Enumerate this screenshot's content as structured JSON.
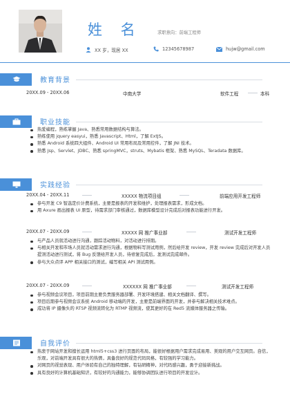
{
  "header": {
    "name": "姓 名",
    "intent": "求职意向：前端工程师",
    "age_location": "XX 岁，现居 XX",
    "phone": "12345678987",
    "email": "hujw@gmail.com"
  },
  "education": {
    "title": "教育背景",
    "period": "20XX.09 - 20XX.06",
    "school": "中南大学",
    "major": "软件工程",
    "degree": "本科"
  },
  "skills": {
    "title": "职业技能",
    "items": [
      "热爱编程，熟练掌握 Java、熟悉常用数据结构与算法。",
      "熟练使用 jquery easyui，熟悉 Javascript、Html，了解 ExtJS。",
      "熟悉 Android 系统四大组件、Android UI 常用布局及常用控件，了解 JNI 技术。",
      "熟悉 Jsp、Servlet、JDBC、熟悉 springMVC，struts、Mybatis 框架、熟悉 MySQL、Teradata 数据库。"
    ]
  },
  "experience": {
    "title": "实践经验",
    "jobs": [
      {
        "period": "20XX.04 - 20XX.11",
        "project": "XXXXX 物流项目组",
        "role": "前端应用开发工程师",
        "items": [
          "参与开发 C9 智选定价计费系统，主要是报表的开发和维护，处理报表需求，形成文档。",
          "用 Axure 画出报表 UI 原型，待需求部门审核通过，数据库模型设计完成后对报表功能进行开发。"
        ]
      },
      {
        "period": "20XX.07 - 20XX.09",
        "project": "XXXXX 网 推广事业部",
        "role": "测试开发工程师",
        "items": [
          "与产品人员就活动进行沟通，跟踪活动物料，对活动进行排期。",
          "与相关开发和市场人员就活动需求进行沟通，根据物料写测试用例，然后给开发 review，开发 review 完成后对开发人员提测活动进行测试，将 Bug 反馈给开发人员，待修复完成后，发测试完成邮件。",
          "参与大众点评 APP 相关接口的测试，编写相关 API 测试用例。"
        ]
      },
      {
        "period": "20XX.07 - 20XX.09",
        "project": "XXXXXX 网 推广事业部",
        "role": "测试开发工程师",
        "items": [
          "参与视频会议项目，项目前期主要负责服务器部署、开发环境搭建、相关文档翻译、撰写。",
          "项目后期参与视频会议系统 Android 移动端的开发，主要是前端界面的开发，并参与解决相关技术难点。",
          "成功将 IP 摄像头的 RTSP 视频流转化为 RTMP 视频流，使其更好的在 Red5 流媒体服务器之传输。"
        ]
      }
    ]
  },
  "self_eval": {
    "title": "自我评价",
    "items": [
      "热衷于网站开发和擅长运用 html5+css3 进行页面的布局，能很好根据用户需求完成易用、美观的用户交互网页。自信，乐观，对前端开发具有很大的热情，具备良好的规范代码风格，有较强的学习能力。",
      "对网页的视觉表现、用户体验有自己的独特理解，有钻研精神，对代码感兴趣，勇于迎接新挑战。",
      "具有良好的计算机基础知识，有较好的沟通能力，能够协调团队进行项目的开发设计。"
    ]
  },
  "colors": {
    "accent": "#4a90d9",
    "text": "#444444"
  }
}
